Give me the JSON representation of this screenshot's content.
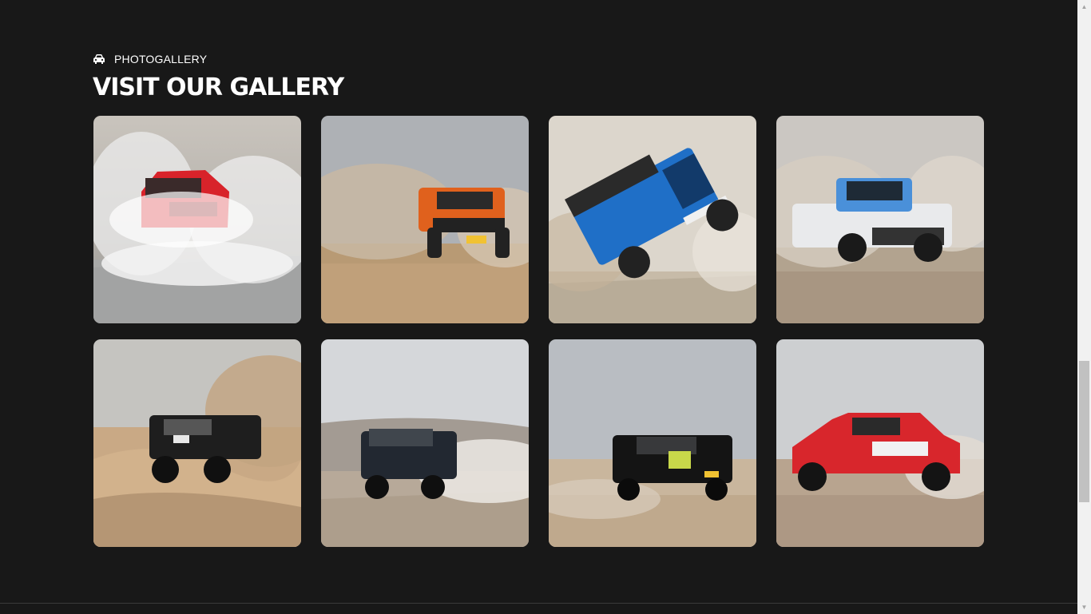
{
  "section": {
    "eyebrow_icon": "car-icon",
    "eyebrow": "PHOTOGALLERY",
    "title": "VISIT OUR GALLERY"
  },
  "gallery": {
    "items": [
      {
        "alt": "Red pickup splashing through water",
        "color": "#d8232a"
      },
      {
        "alt": "Orange truck in desert dust",
        "color": "#e0611d"
      },
      {
        "alt": "Blue jeep tilting on two wheels",
        "color": "#1f6fc7"
      },
      {
        "alt": "Blue and white pickup in dust",
        "color": "#4a90d9"
      },
      {
        "alt": "Black pickup on sandy terrain",
        "color": "#1e1e1e"
      },
      {
        "alt": "Black Toyota pickup jumping",
        "color": "#222831"
      },
      {
        "alt": "Black pickup with yellow graphics",
        "color": "#141414"
      },
      {
        "alt": "Red rally car GOBI",
        "color": "#d8262c"
      }
    ]
  },
  "colors": {
    "background": "#181818",
    "text": "#ffffff"
  }
}
